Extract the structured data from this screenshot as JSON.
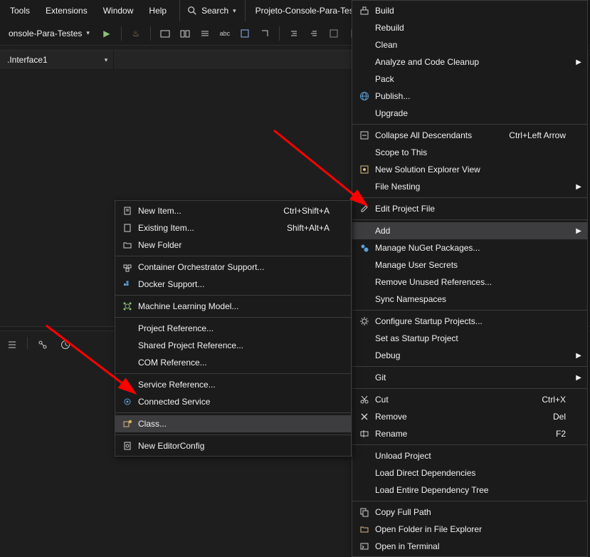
{
  "menubar": {
    "items": [
      "Tools",
      "Extensions",
      "Window",
      "Help"
    ],
    "search": "Search",
    "project": "Projeto-Console-Para-Testes"
  },
  "toolbar": {
    "config": "onsole-Para-Testes"
  },
  "crumb": {
    "ns": ".Interface1"
  },
  "contextRight": [
    {
      "t": "item",
      "icon": "build-icon",
      "label": "Build"
    },
    {
      "t": "item",
      "label": "Rebuild"
    },
    {
      "t": "item",
      "label": "Clean"
    },
    {
      "t": "item",
      "label": "Analyze and Code Cleanup",
      "sub": true
    },
    {
      "t": "item",
      "label": "Pack"
    },
    {
      "t": "item",
      "icon": "globe-icon",
      "label": "Publish..."
    },
    {
      "t": "item",
      "label": "Upgrade"
    },
    {
      "t": "sep"
    },
    {
      "t": "item",
      "icon": "collapse-icon",
      "label": "Collapse All Descendants",
      "shortcut": "Ctrl+Left Arrow"
    },
    {
      "t": "item",
      "label": "Scope to This"
    },
    {
      "t": "item",
      "icon": "solution-icon",
      "label": "New Solution Explorer View"
    },
    {
      "t": "item",
      "label": "File Nesting",
      "sub": true
    },
    {
      "t": "sep"
    },
    {
      "t": "item",
      "icon": "edit-icon",
      "label": "Edit Project File"
    },
    {
      "t": "sep"
    },
    {
      "t": "item",
      "label": "Add",
      "sub": true,
      "hl": true
    },
    {
      "t": "item",
      "icon": "nuget-icon",
      "label": "Manage NuGet Packages..."
    },
    {
      "t": "item",
      "label": "Manage User Secrets"
    },
    {
      "t": "item",
      "label": "Remove Unused References..."
    },
    {
      "t": "item",
      "label": "Sync Namespaces"
    },
    {
      "t": "sep"
    },
    {
      "t": "item",
      "icon": "gear-icon",
      "label": "Configure Startup Projects..."
    },
    {
      "t": "item",
      "label": "Set as Startup Project"
    },
    {
      "t": "item",
      "label": "Debug",
      "sub": true
    },
    {
      "t": "sep"
    },
    {
      "t": "item",
      "label": "Git",
      "sub": true
    },
    {
      "t": "sep"
    },
    {
      "t": "item",
      "icon": "cut-icon",
      "label": "Cut",
      "shortcut": "Ctrl+X"
    },
    {
      "t": "item",
      "icon": "remove-icon",
      "label": "Remove",
      "shortcut": "Del"
    },
    {
      "t": "item",
      "icon": "rename-icon",
      "label": "Rename",
      "shortcut": "F2"
    },
    {
      "t": "sep"
    },
    {
      "t": "item",
      "label": "Unload Project"
    },
    {
      "t": "item",
      "label": "Load Direct Dependencies"
    },
    {
      "t": "item",
      "label": "Load Entire Dependency Tree"
    },
    {
      "t": "sep"
    },
    {
      "t": "item",
      "icon": "copy-icon",
      "label": "Copy Full Path"
    },
    {
      "t": "item",
      "icon": "folder-open-icon",
      "label": "Open Folder in File Explorer"
    },
    {
      "t": "item",
      "icon": "terminal-icon",
      "label": "Open in Terminal"
    }
  ],
  "contextLeft": [
    {
      "t": "item",
      "icon": "new-item-icon",
      "label": "New Item...",
      "shortcut": "Ctrl+Shift+A"
    },
    {
      "t": "item",
      "icon": "existing-item-icon",
      "label": "Existing Item...",
      "shortcut": "Shift+Alt+A"
    },
    {
      "t": "item",
      "icon": "new-folder-icon",
      "label": "New Folder"
    },
    {
      "t": "sep"
    },
    {
      "t": "item",
      "icon": "container-icon",
      "label": "Container Orchestrator Support..."
    },
    {
      "t": "item",
      "icon": "docker-icon",
      "label": "Docker Support..."
    },
    {
      "t": "sep"
    },
    {
      "t": "item",
      "icon": "ml-icon",
      "label": "Machine Learning Model..."
    },
    {
      "t": "sep"
    },
    {
      "t": "item",
      "label": "Project Reference..."
    },
    {
      "t": "item",
      "label": "Shared Project Reference..."
    },
    {
      "t": "item",
      "label": "COM Reference..."
    },
    {
      "t": "sep"
    },
    {
      "t": "item",
      "label": "Service Reference..."
    },
    {
      "t": "item",
      "icon": "connected-icon",
      "label": "Connected Service"
    },
    {
      "t": "sep"
    },
    {
      "t": "item",
      "icon": "class-icon",
      "label": "Class...",
      "hl": true
    },
    {
      "t": "sep"
    },
    {
      "t": "item",
      "icon": "editorconfig-icon",
      "label": "New EditorConfig"
    }
  ]
}
